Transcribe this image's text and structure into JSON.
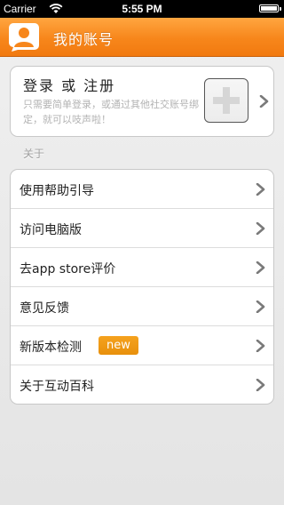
{
  "status_bar": {
    "carrier": "Carrier",
    "time": "5:55 PM"
  },
  "nav": {
    "title": "我的账号",
    "avatar_icon": "user-avatar-icon"
  },
  "login": {
    "title": "登录 或 注册",
    "subtitle": "只需要简单登录，或通过其他社交账号绑定，就可以吱声啦！"
  },
  "section": {
    "header": "关于"
  },
  "menu": {
    "items": [
      {
        "label": "使用帮助引导"
      },
      {
        "label": "访问电脑版"
      },
      {
        "label": "去app store评价"
      },
      {
        "label": "意见反馈"
      },
      {
        "label": "新版本检测",
        "badge": "new"
      },
      {
        "label": "关于互动百科"
      }
    ]
  },
  "colors": {
    "nav_orange": "#f7861b",
    "badge_orange": "#f0991a",
    "chevron_gray": "#7a7a7a"
  }
}
